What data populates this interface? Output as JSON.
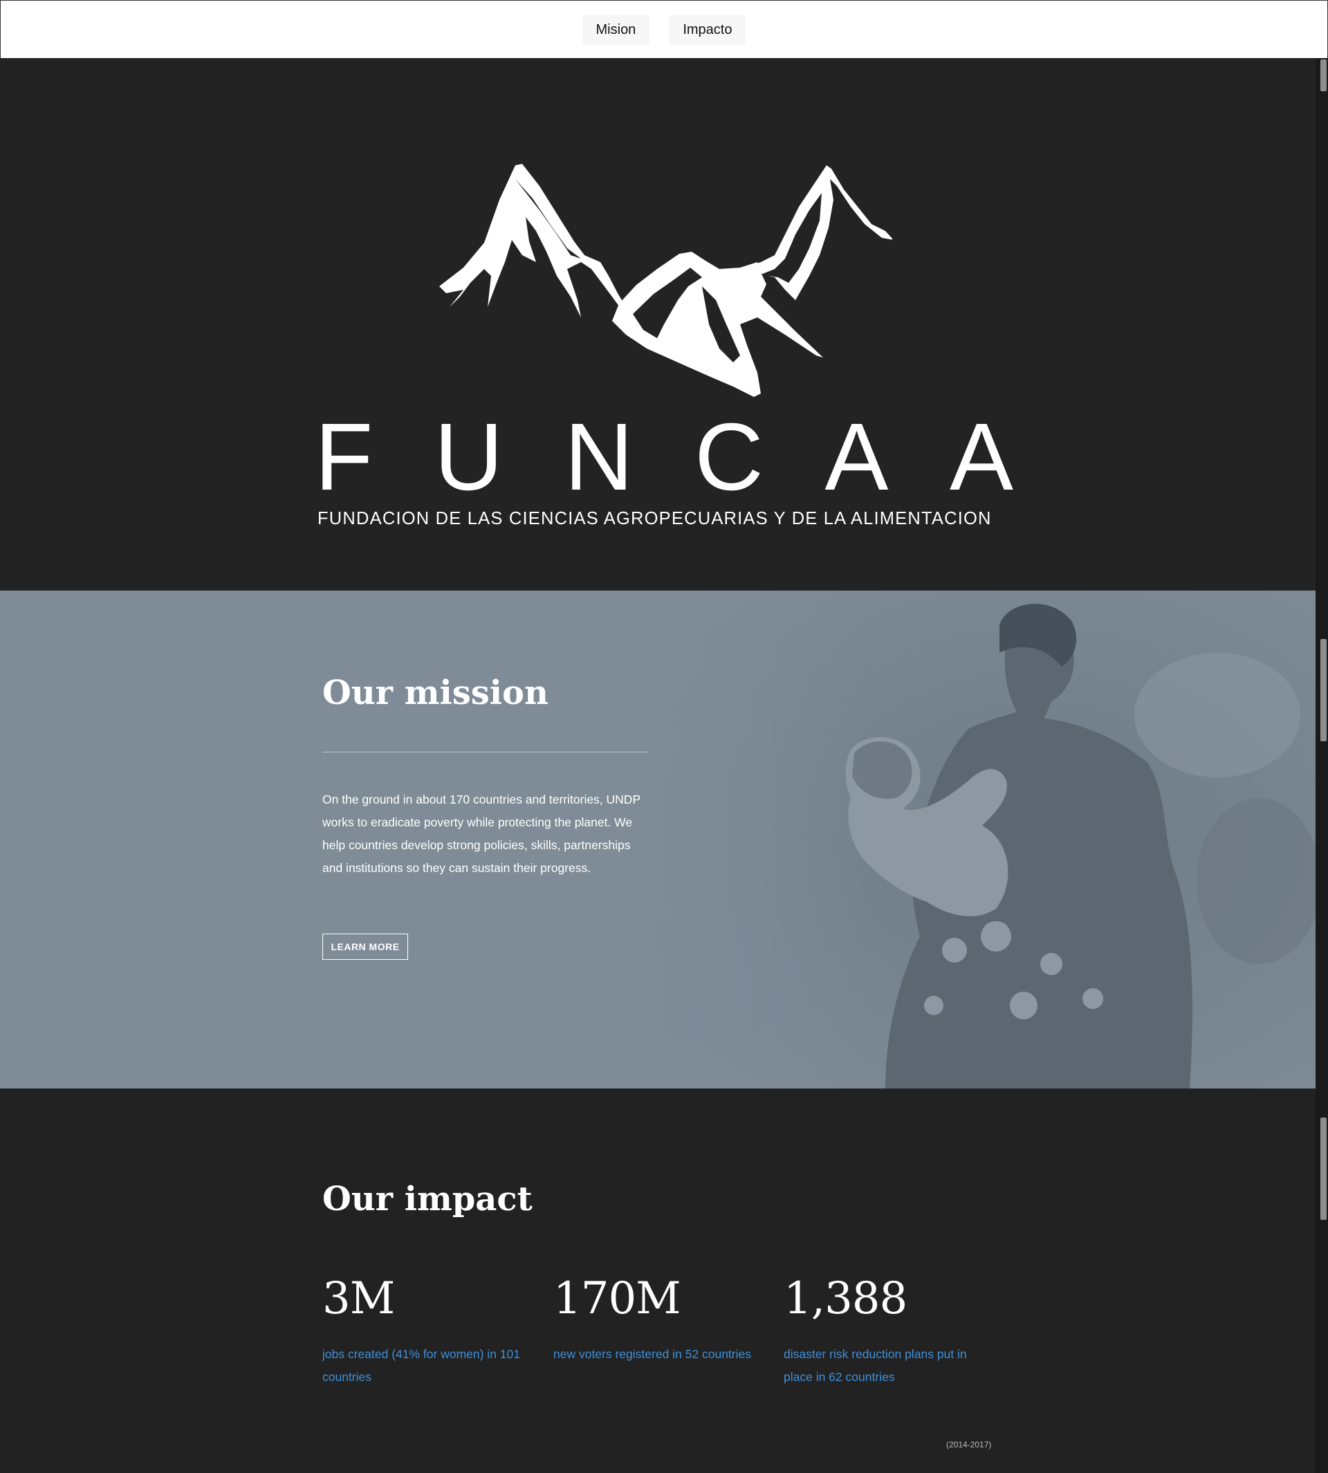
{
  "nav": {
    "items": [
      {
        "label": "Mision"
      },
      {
        "label": "Impacto"
      }
    ]
  },
  "hero": {
    "logo_word": [
      "F",
      "U",
      "N",
      "C",
      "A",
      "A"
    ],
    "logo_subtitle": "FUNDACION DE LAS CIENCIAS AGROPECUARIAS Y DE LA ALIMENTACION"
  },
  "mission": {
    "title": "Our mission",
    "text": "On the ground in about 170 countries and territories, UNDP works to eradicate poverty while protecting the planet. We help countries develop strong policies, skills, partnerships and institutions so they can sustain their progress.",
    "button_label": "LEARN MORE"
  },
  "impact": {
    "title": "Our impact",
    "stats": [
      {
        "value": "3M",
        "description": "jobs created (41% for women) in 101 countries"
      },
      {
        "value": "170M",
        "description": "new voters registered in 52 countries"
      },
      {
        "value": "1,388",
        "description": "disaster risk reduction plans put in place in 62 countries"
      }
    ],
    "note": "(2014-2017)"
  },
  "colors": {
    "nav_background": "#ffffff",
    "page_background": "#222222",
    "mission_background": "#7f8c98",
    "stat_accent": "#3f8fd8"
  }
}
